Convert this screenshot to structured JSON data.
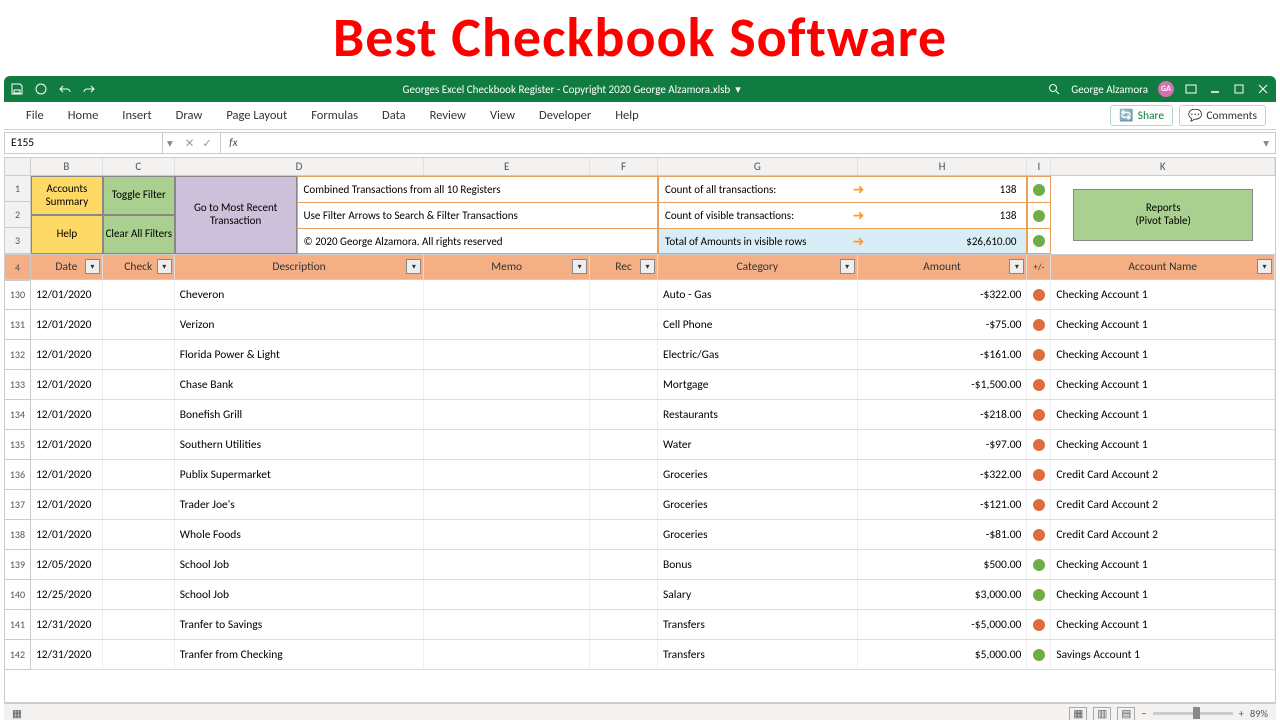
{
  "banner": "Best Checkbook Software",
  "titlebar": {
    "filename": "Georges Excel Checkbook Register  -  Copyright 2020 George Alzamora.xlsb",
    "user": "George Alzamora",
    "initials": "GA"
  },
  "ribbon": {
    "tabs": [
      "File",
      "Home",
      "Insert",
      "Draw",
      "Page Layout",
      "Formulas",
      "Data",
      "Review",
      "View",
      "Developer",
      "Help"
    ],
    "share": "Share",
    "comments": "Comments"
  },
  "namebox": "E155",
  "buttons": {
    "accounts_summary": "Accounts\nSummary",
    "toggle_filter": "Toggle Filter",
    "go_recent": "Go to Most Recent\nTransaction",
    "help": "Help",
    "clear_filters": "Clear All Filters",
    "reports": "Reports\n(Pivot Table)"
  },
  "info": {
    "line1": "Combined Transactions from all 10 Registers",
    "line2": "Use Filter Arrows to Search & Filter Transactions",
    "line3": "© 2020 George Alzamora. All rights reserved",
    "count_all_label": "Count of all transactions:",
    "count_all_val": "138",
    "count_vis_label": "Count of visible transactions:",
    "count_vis_val": "138",
    "total_label": "Total of Amounts in visible rows",
    "total_val": "$26,610.00"
  },
  "cols": [
    "B",
    "C",
    "D",
    "E",
    "F",
    "G",
    "H",
    "I",
    "K"
  ],
  "headers": {
    "date": "Date",
    "check": "Check",
    "desc": "Description",
    "memo": "Memo",
    "rec": "Rec",
    "cat": "Category",
    "amt": "Amount",
    "plus": "+/-",
    "acct": "Account Name"
  },
  "rownums_top": [
    "1",
    "2",
    "3"
  ],
  "rows": [
    {
      "n": "130",
      "date": "12/01/2020",
      "desc": "Cheveron",
      "cat": "Auto - Gas",
      "amt": "-$322.00",
      "pos": false,
      "acct": "Checking Account 1"
    },
    {
      "n": "131",
      "date": "12/01/2020",
      "desc": "Verizon",
      "cat": "Cell Phone",
      "amt": "-$75.00",
      "pos": false,
      "acct": "Checking Account 1"
    },
    {
      "n": "132",
      "date": "12/01/2020",
      "desc": "Florida Power & Light",
      "cat": "Electric/Gas",
      "amt": "-$161.00",
      "pos": false,
      "acct": "Checking Account 1"
    },
    {
      "n": "133",
      "date": "12/01/2020",
      "desc": "Chase Bank",
      "cat": "Mortgage",
      "amt": "-$1,500.00",
      "pos": false,
      "acct": "Checking Account 1"
    },
    {
      "n": "134",
      "date": "12/01/2020",
      "desc": "Bonefish Grill",
      "cat": "Restaurants",
      "amt": "-$218.00",
      "pos": false,
      "acct": "Checking Account 1"
    },
    {
      "n": "135",
      "date": "12/01/2020",
      "desc": "Southern Utilities",
      "cat": "Water",
      "amt": "-$97.00",
      "pos": false,
      "acct": "Checking Account 1"
    },
    {
      "n": "136",
      "date": "12/01/2020",
      "desc": "Publix Supermarket",
      "cat": "Groceries",
      "amt": "-$322.00",
      "pos": false,
      "acct": "Credit Card Account 2"
    },
    {
      "n": "137",
      "date": "12/01/2020",
      "desc": "Trader Joe's",
      "cat": "Groceries",
      "amt": "-$121.00",
      "pos": false,
      "acct": "Credit Card Account 2"
    },
    {
      "n": "138",
      "date": "12/01/2020",
      "desc": "Whole Foods",
      "cat": "Groceries",
      "amt": "-$81.00",
      "pos": false,
      "acct": "Credit Card Account 2"
    },
    {
      "n": "139",
      "date": "12/05/2020",
      "desc": "School Job",
      "cat": "Bonus",
      "amt": "$500.00",
      "pos": true,
      "acct": "Checking Account 1"
    },
    {
      "n": "140",
      "date": "12/25/2020",
      "desc": "School Job",
      "cat": "Salary",
      "amt": "$3,000.00",
      "pos": true,
      "acct": "Checking Account 1"
    },
    {
      "n": "141",
      "date": "12/31/2020",
      "desc": "Tranfer to Savings",
      "cat": "Transfers",
      "amt": "-$5,000.00",
      "pos": false,
      "acct": "Checking Account 1"
    },
    {
      "n": "142",
      "date": "12/31/2020",
      "desc": "Tranfer from Checking",
      "cat": "Transfers",
      "amt": "$5,000.00",
      "pos": true,
      "acct": "Savings Account 1"
    }
  ],
  "statusbar": {
    "zoom": "89%"
  }
}
